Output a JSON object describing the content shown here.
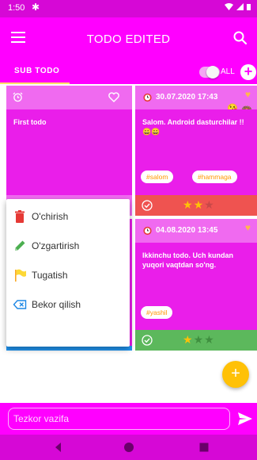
{
  "status": {
    "time": "1:50"
  },
  "appbar": {
    "title": "TODO EDITED"
  },
  "tabs": {
    "sub_todo": "SUB TODO",
    "all_label": "ALL"
  },
  "cards": [
    {
      "id": "c1",
      "text": "First todo",
      "stars": 0,
      "tags": []
    },
    {
      "id": "c2",
      "date": "30.07.2020 17:43",
      "text": "Salom. Android dasturchilar !! 😀😀",
      "tags": [
        "#salom",
        "#hammaga"
      ],
      "stars": 2
    },
    {
      "id": "c3",
      "date": "04.08.2020 13:45",
      "text": "Ikkinchu todo. Uch kundan yuqori vaqtdan so'ng.",
      "tags": [
        "#yashil"
      ],
      "stars": 1
    }
  ],
  "menu": {
    "items": [
      {
        "label": "O'chirish",
        "icon": "trash-icon"
      },
      {
        "label": "O'zgartirish",
        "icon": "pencil-icon"
      },
      {
        "label": "Tugatish",
        "icon": "flag-icon"
      },
      {
        "label": "Bekor qilish",
        "icon": "backspace-icon"
      }
    ]
  },
  "quick": {
    "placeholder": "Tezkor vazifa"
  },
  "colors": {
    "primary": "#ff00ff",
    "card_pink": "#e91ee9",
    "card_green": "#5cb85c",
    "card_red": "#ef5350",
    "star_on": "#ffc107",
    "fab": "#ffc107"
  }
}
